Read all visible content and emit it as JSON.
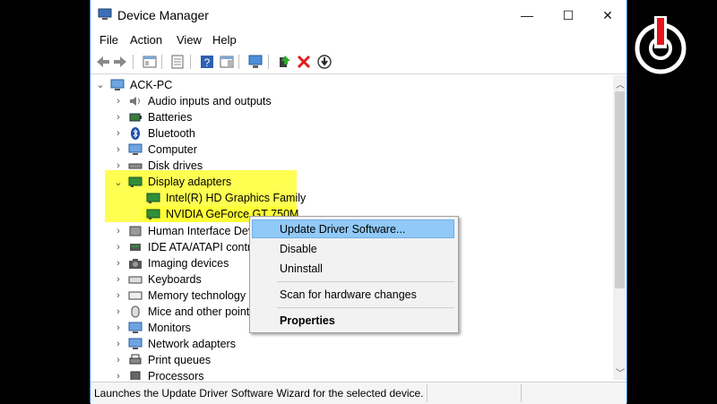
{
  "window": {
    "title": "Device Manager",
    "controls": {
      "minimize": "—",
      "maximize": "☐",
      "close": "✕"
    }
  },
  "menu": [
    "File",
    "Action",
    "View",
    "Help"
  ],
  "tree": {
    "root": "ACK-PC",
    "items": [
      {
        "label": "Audio inputs and outputs",
        "icon": "speaker-icon",
        "expanded": false
      },
      {
        "label": "Batteries",
        "icon": "battery-icon",
        "expanded": false
      },
      {
        "label": "Bluetooth",
        "icon": "bluetooth-icon",
        "expanded": false
      },
      {
        "label": "Computer",
        "icon": "computer-icon",
        "expanded": false
      },
      {
        "label": "Disk drives",
        "icon": "disk-icon",
        "expanded": false
      },
      {
        "label": "Display adapters",
        "icon": "display-adapter-icon",
        "expanded": true
      },
      {
        "label": "Intel(R) HD Graphics Family",
        "icon": "display-adapter-icon",
        "child": true
      },
      {
        "label": "NVIDIA GeForce GT 750M",
        "icon": "display-adapter-icon",
        "child": true
      },
      {
        "label": "Human Interface Devices",
        "icon": "hid-icon",
        "expanded": false
      },
      {
        "label": "IDE ATA/ATAPI controllers",
        "icon": "ide-icon",
        "expanded": false
      },
      {
        "label": "Imaging devices",
        "icon": "camera-icon",
        "expanded": false
      },
      {
        "label": "Keyboards",
        "icon": "keyboard-icon",
        "expanded": false
      },
      {
        "label": "Memory technology devices",
        "icon": "memory-icon",
        "expanded": false
      },
      {
        "label": "Mice and other pointing devices",
        "icon": "mouse-icon",
        "expanded": false
      },
      {
        "label": "Monitors",
        "icon": "monitor-icon",
        "expanded": false
      },
      {
        "label": "Network adapters",
        "icon": "network-icon",
        "expanded": false
      },
      {
        "label": "Print queues",
        "icon": "printer-icon",
        "expanded": false
      },
      {
        "label": "Processors",
        "icon": "processor-icon",
        "expanded": false
      }
    ]
  },
  "context_menu": {
    "items": [
      "Update Driver Software...",
      "Disable",
      "Uninstall",
      "Scan for hardware changes",
      "Properties"
    ],
    "selected": "Update Driver Software..."
  },
  "status": "Launches the Update Driver Software Wizard for the selected device.",
  "colors": {
    "highlight": "#ffff33",
    "selection": "#91c9f7",
    "logo_red": "#e8141c"
  }
}
